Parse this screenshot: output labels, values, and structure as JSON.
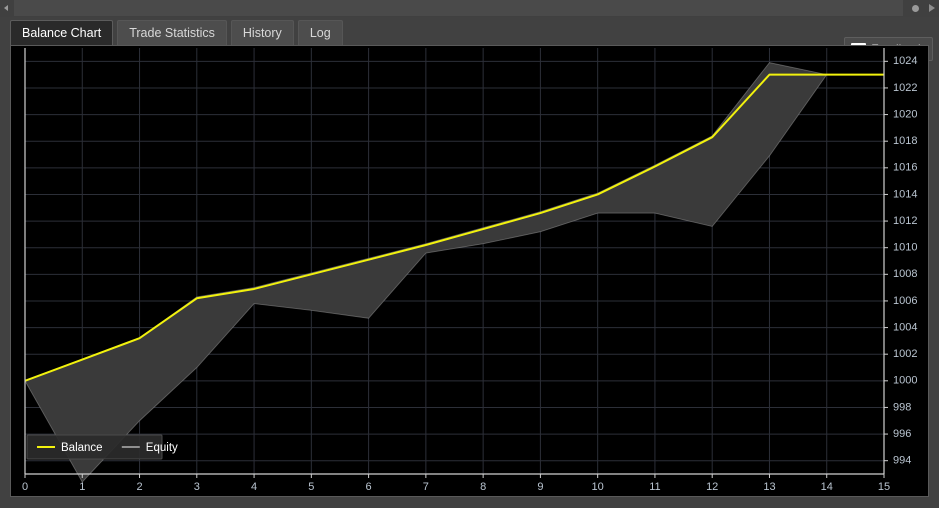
{
  "window": {
    "scrollbar": {
      "left_arrow_icon": "triangle-left-icon",
      "handle_icon": "dot-icon",
      "right_arrow_icon": "triangle-right-icon"
    }
  },
  "tabs": [
    {
      "label": "Balance Chart",
      "active": true
    },
    {
      "label": "Trade Statistics",
      "active": false
    },
    {
      "label": "History",
      "active": false
    },
    {
      "label": "Log",
      "active": false
    }
  ],
  "feedback": {
    "label": "Feedback",
    "icon": "speech-bubble-icon"
  },
  "colors": {
    "balance": "#f2f20d",
    "equity_fill": "#3a3a3a",
    "equity_stroke": "#8f8f8f",
    "grid": "#2c2f38",
    "axis": "#d0d0d0",
    "plot_background": "#000000",
    "panel_background": "#000000",
    "window_background": "#414141",
    "tab_active_background": "#2a2a2a",
    "tab_inactive_background": "#4d4d4d",
    "tick_label": "#b9c4d0"
  },
  "chart_data": {
    "type": "line",
    "title": "",
    "xlabel": "",
    "ylabel": "",
    "grid": true,
    "legend_position": "bottom-left",
    "xlim": [
      0,
      15
    ],
    "ylim": [
      993,
      1025
    ],
    "xticks": [
      0,
      1,
      2,
      3,
      4,
      5,
      6,
      7,
      8,
      9,
      10,
      11,
      12,
      13,
      14,
      15
    ],
    "yticks": [
      994,
      996,
      998,
      1000,
      1002,
      1004,
      1006,
      1008,
      1010,
      1012,
      1014,
      1016,
      1018,
      1020,
      1022,
      1024
    ],
    "x": [
      0,
      1,
      2,
      3,
      4,
      5,
      6,
      7,
      8,
      9,
      10,
      11,
      12,
      13,
      14,
      15
    ],
    "series": [
      {
        "name": "Balance",
        "type": "line",
        "color": "#f2f20d",
        "values": [
          1000.0,
          1001.6,
          1003.2,
          1006.2,
          1006.9,
          1008.0,
          1009.1,
          1010.2,
          1011.4,
          1012.6,
          1014.0,
          1016.1,
          1018.3,
          1023.0,
          1023.0,
          1023.0
        ]
      },
      {
        "name": "Equity",
        "type": "band",
        "color": "#3a3a3a",
        "upper": [
          1000.0,
          1001.6,
          1003.2,
          1006.3,
          1007.0,
          1008.1,
          1009.2,
          1010.3,
          1011.5,
          1012.7,
          1014.1,
          1016.2,
          1018.4,
          1023.9,
          1023.0,
          1023.0
        ],
        "lower": [
          1000.0,
          992.4,
          997.0,
          1001.0,
          1005.8,
          1005.3,
          1004.7,
          1009.6,
          1010.3,
          1011.2,
          1012.6,
          1012.6,
          1011.6,
          1016.9,
          1023.0,
          1023.0
        ]
      }
    ],
    "legend": [
      {
        "label": "Balance",
        "marker": "line",
        "color": "#f2f20d"
      },
      {
        "label": "Equity",
        "marker": "line",
        "color": "#8f8f8f"
      }
    ]
  }
}
